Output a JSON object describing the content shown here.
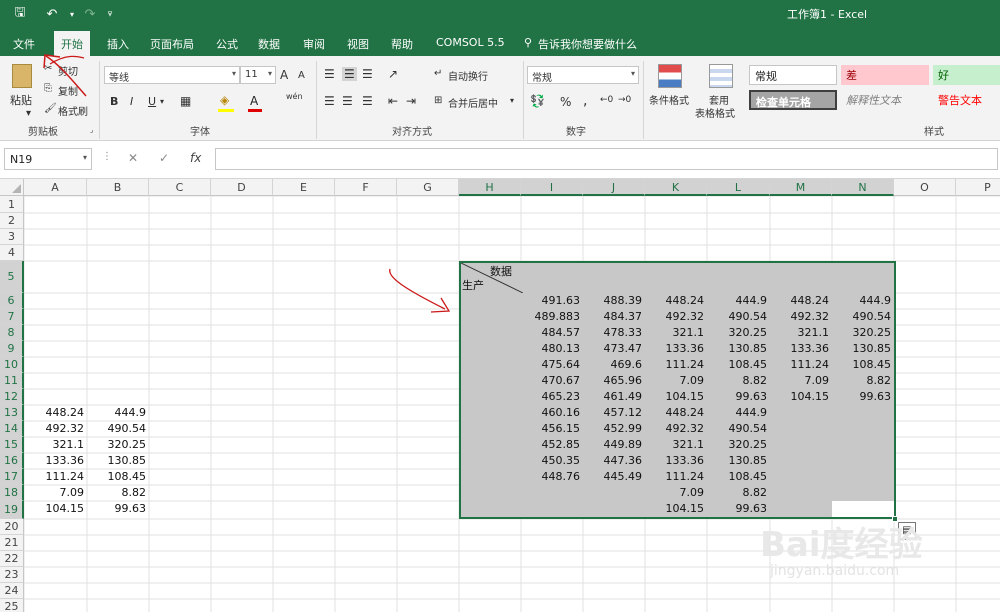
{
  "window": {
    "title": "工作簿1  -  Excel"
  },
  "menu": [
    {
      "label": "文件"
    },
    {
      "label": "开始"
    },
    {
      "label": "插入"
    },
    {
      "label": "页面布局"
    },
    {
      "label": "公式"
    },
    {
      "label": "数据"
    },
    {
      "label": "审阅"
    },
    {
      "label": "视图"
    },
    {
      "label": "帮助"
    },
    {
      "label": "COMSOL 5.5"
    }
  ],
  "tell_me": "告诉我你想要做什么",
  "ribbon": {
    "clipboard": {
      "label": "剪贴板",
      "paste": "粘贴",
      "cut": "剪切",
      "copy": "复制",
      "format_painter": "格式刷"
    },
    "font": {
      "label": "字体",
      "font_name": "等线",
      "font_size": "11",
      "grow": "A",
      "shrink": "A",
      "bold": "B",
      "italic": "I",
      "underline": "U",
      "font_color": "A",
      "wen": "wén"
    },
    "alignment": {
      "label": "对齐方式",
      "wrap": "自动换行",
      "merge": "合并后居中"
    },
    "number": {
      "label": "数字",
      "format": "常规",
      "percent": "%",
      "comma": ","
    },
    "styles_group": {
      "label": "样式",
      "conditional": "条件格式",
      "table_line1": "套用",
      "table_line2": "表格格式",
      "normal": "常规",
      "bad": "差",
      "good": "好",
      "check": "检查单元格",
      "explanatory": "解释性文本",
      "warning": "警告文本"
    }
  },
  "formula_bar": {
    "name_box": "N19",
    "cancel": "✕",
    "enter": "✓",
    "fx": "fx",
    "content": ""
  },
  "sheet": {
    "columns": [
      "A",
      "B",
      "C",
      "D",
      "E",
      "F",
      "G",
      "H",
      "I",
      "J",
      "K",
      "L",
      "M",
      "N",
      "O",
      "P"
    ],
    "rows": [
      "1",
      "2",
      "3",
      "4",
      "5",
      "6",
      "7",
      "8",
      "9",
      "10",
      "11",
      "12",
      "13",
      "14",
      "15",
      "16",
      "17",
      "18",
      "19",
      "20",
      "21",
      "22",
      "23",
      "24",
      "25"
    ],
    "header_cell": {
      "top_text": "数据",
      "bottom_text": "生产"
    },
    "colA": [
      "448.24",
      "492.32",
      "321.1",
      "133.36",
      "111.24",
      "7.09",
      "104.15"
    ],
    "colB": [
      "444.9",
      "490.54",
      "320.25",
      "130.85",
      "108.45",
      "8.82",
      "99.63"
    ],
    "colI": [
      "491.63",
      "489.883",
      "484.57",
      "480.13",
      "475.64",
      "470.67",
      "465.23",
      "460.16",
      "456.15",
      "452.85",
      "450.35",
      "448.76"
    ],
    "colJ": [
      "488.39",
      "484.37",
      "478.33",
      "473.47",
      "469.6",
      "465.96",
      "461.49",
      "457.12",
      "452.99",
      "449.89",
      "447.36",
      "445.49"
    ],
    "colK": [
      "448.24",
      "492.32",
      "321.1",
      "133.36",
      "111.24",
      "7.09",
      "104.15",
      "448.24",
      "492.32",
      "321.1",
      "133.36",
      "111.24",
      "7.09",
      "104.15"
    ],
    "colL": [
      "444.9",
      "490.54",
      "320.25",
      "130.85",
      "108.45",
      "8.82",
      "99.63",
      "444.9",
      "490.54",
      "320.25",
      "130.85",
      "108.45",
      "8.82",
      "99.63"
    ],
    "colM": [
      "448.24",
      "492.32",
      "321.1",
      "133.36",
      "111.24",
      "7.09",
      "104.15"
    ],
    "colN": [
      "444.9",
      "490.54",
      "320.25",
      "130.85",
      "108.45",
      "8.82",
      "99.63"
    ]
  },
  "watermark": {
    "text": "Bai度经验",
    "url": "jingyan.baidu.com"
  },
  "colors": {
    "excel_green": "#217346",
    "selection_gray": "#c8c8c8",
    "annotation_red": "#cc1a1a"
  }
}
